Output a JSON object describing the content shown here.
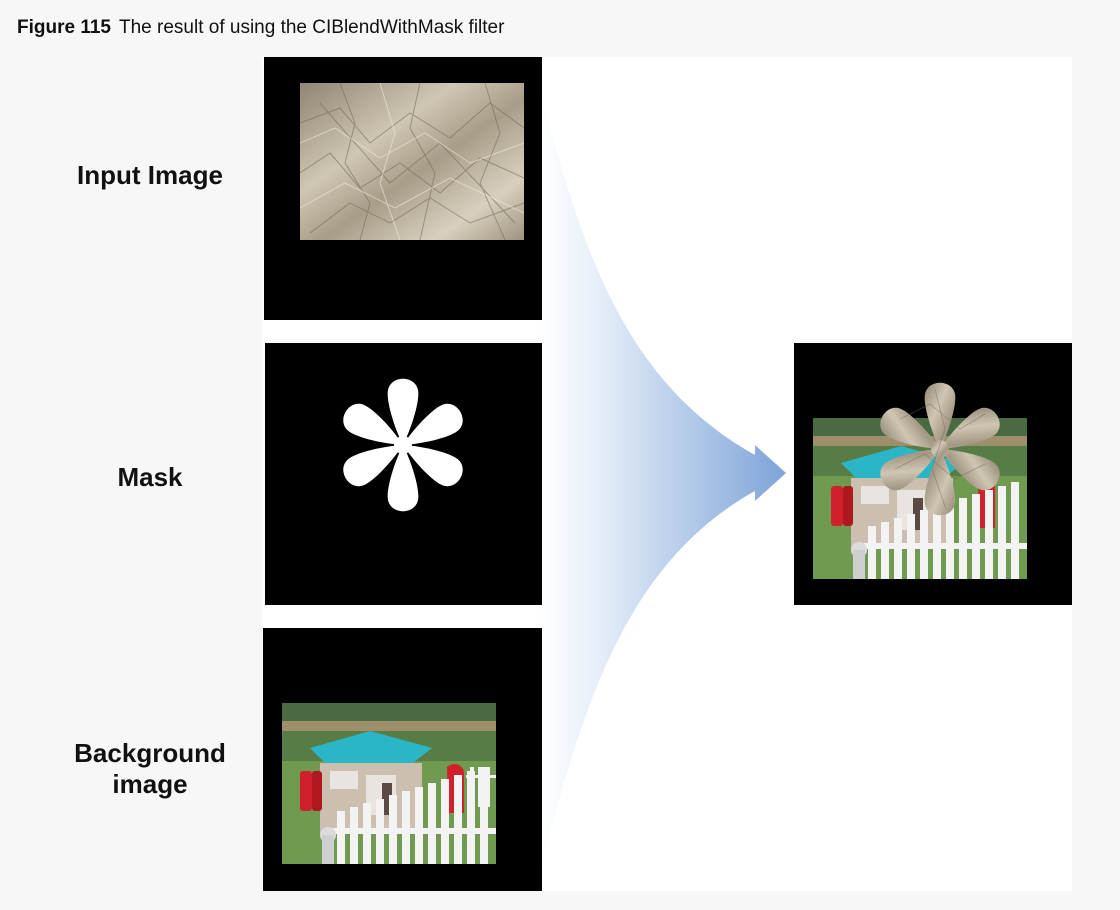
{
  "figure": {
    "number": "Figure 115",
    "title": "The result of using the CIBlendWithMask filter"
  },
  "labels": {
    "input": "Input Image",
    "mask": "Mask",
    "background_line1": "Background",
    "background_line2": "image"
  },
  "colors": {
    "arrow": "#7da3d8",
    "house_roof": "#2bb6c8",
    "shutters": "#d0202c",
    "paper": "#b6ab97"
  }
}
